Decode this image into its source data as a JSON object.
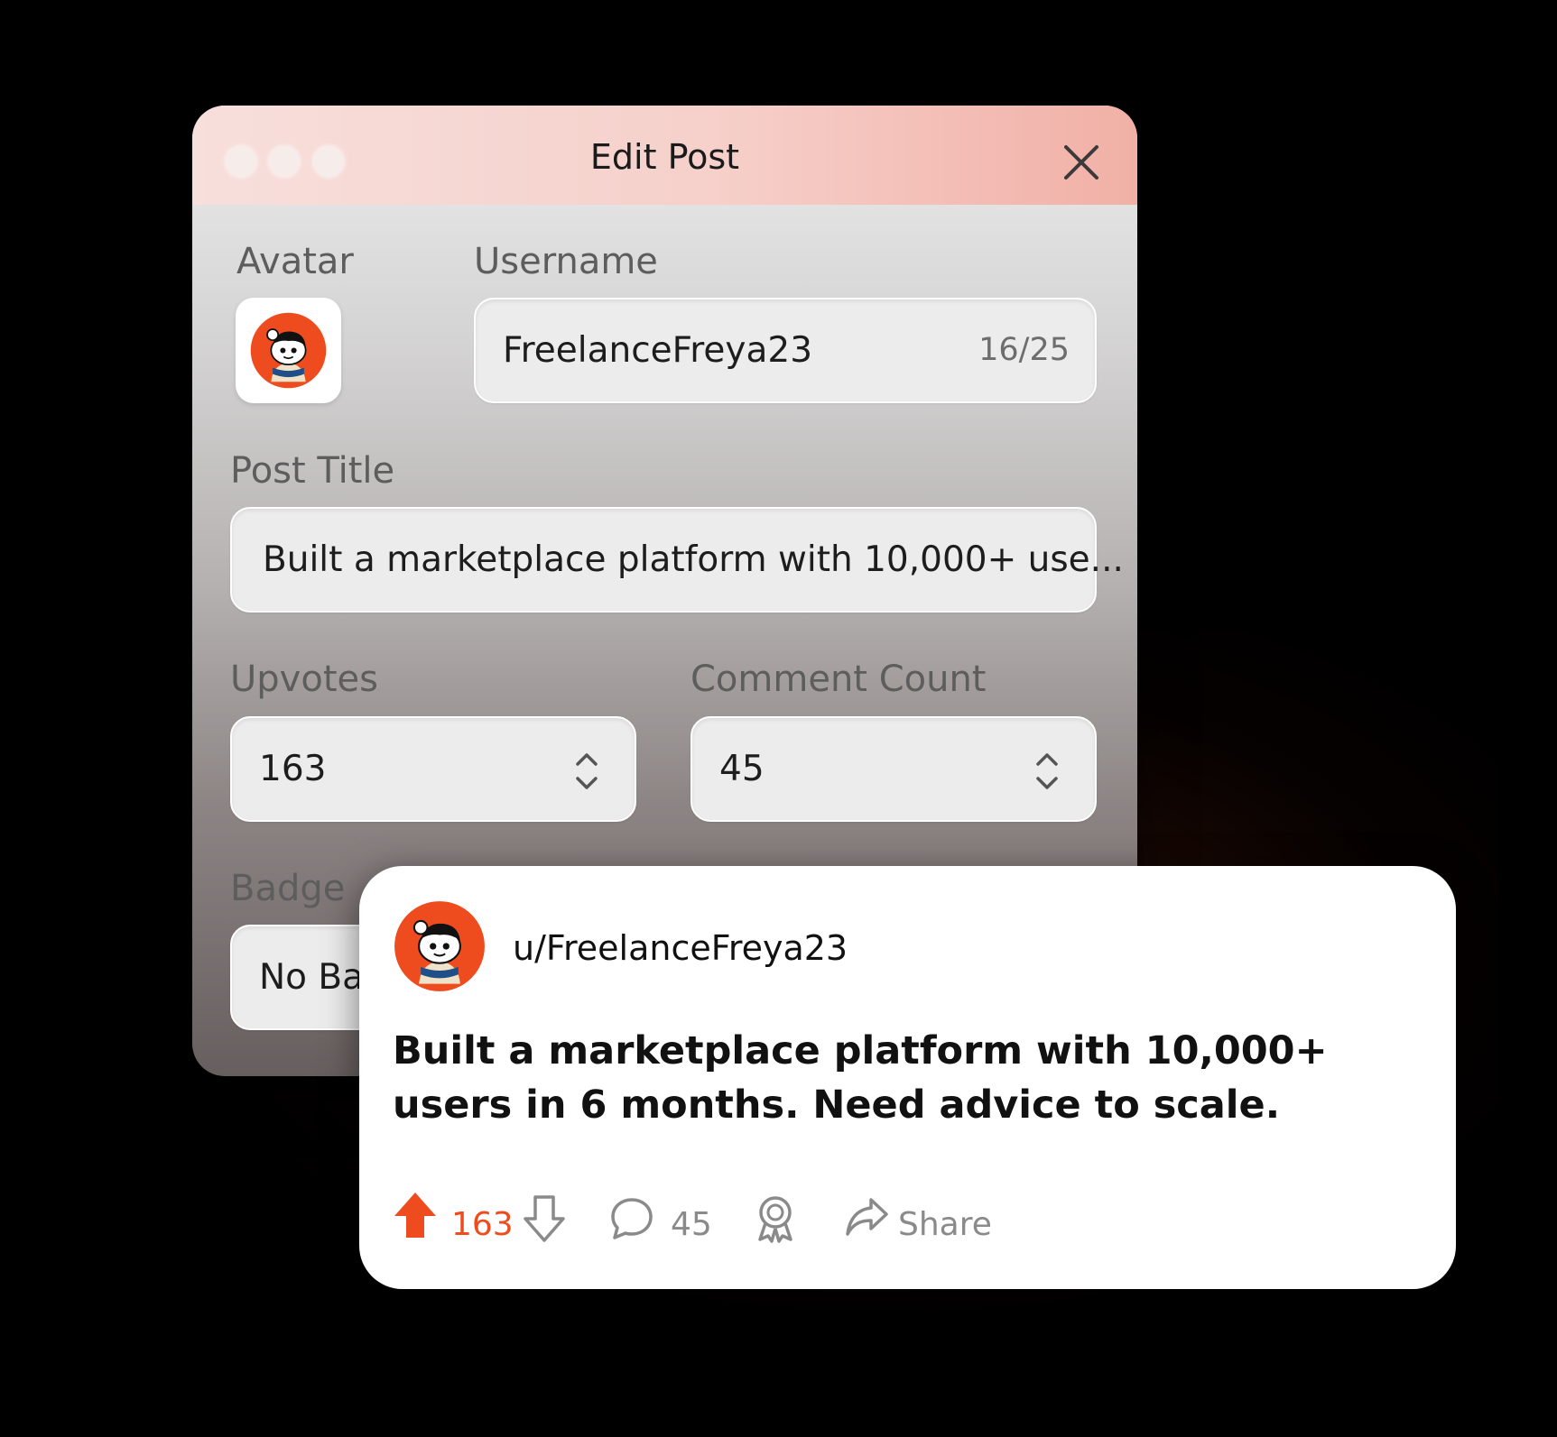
{
  "window": {
    "title": "Edit Post",
    "avatar_label": "Avatar",
    "username_label": "Username",
    "username_value": "FreelanceFreya23",
    "username_counter": "16/25",
    "post_title_label": "Post Title",
    "post_title_value": "Built a marketplace platform with 10,000+ use...",
    "upvotes_label": "Upvotes",
    "upvotes_value": "163",
    "comment_count_label": "Comment Count",
    "comment_count_value": "45",
    "badge_label": "Badge",
    "badge_value": "No Ba"
  },
  "post": {
    "username": "u/FreelanceFreya23",
    "title": "Built a marketplace platform with 10,000+ users in 6 months. Need advice to scale.",
    "upvotes": "163",
    "comments": "45",
    "share_label": "Share"
  },
  "colors": {
    "accent": "#ee4c1f",
    "titlebar_tint": "#f4c3bb"
  },
  "icons": [
    "close-icon",
    "avatar-icon",
    "stepper-icon",
    "upvote-icon",
    "downvote-icon",
    "comment-icon",
    "award-icon",
    "share-icon"
  ]
}
